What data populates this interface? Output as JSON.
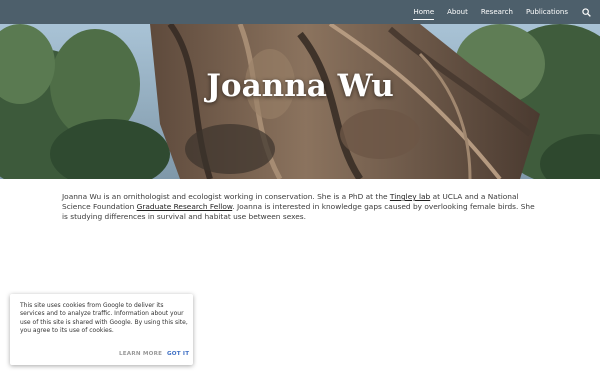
{
  "header": {
    "nav": [
      "Home",
      "About",
      "Research",
      "Publications"
    ],
    "search_icon": "search-icon",
    "bar_color": "#4d5f6b"
  },
  "hero": {
    "title": "Joanna Wu"
  },
  "bio": {
    "part1": "Joanna Wu is an ornithologist and ecologist working in conservation. She is a PhD  at the ",
    "link1": "Tingley lab",
    "part2": " at UCLA and a National Science Foundation ",
    "link2": "Graduate Research Fellow",
    "part3": ". Joanna is interested in knowledge gaps caused by overlooking female birds. She is studying differences in survival and habitat use between sexes."
  },
  "cookie": {
    "text": "This site uses cookies from Google to deliver its services and to analyze traffic. Information about your use of this site is shared with Google. By using this site, you agree to its use of cookies.",
    "learn_more": "LEARN MORE",
    "got_it": "GOT IT",
    "accent": "#3d6fc4"
  }
}
